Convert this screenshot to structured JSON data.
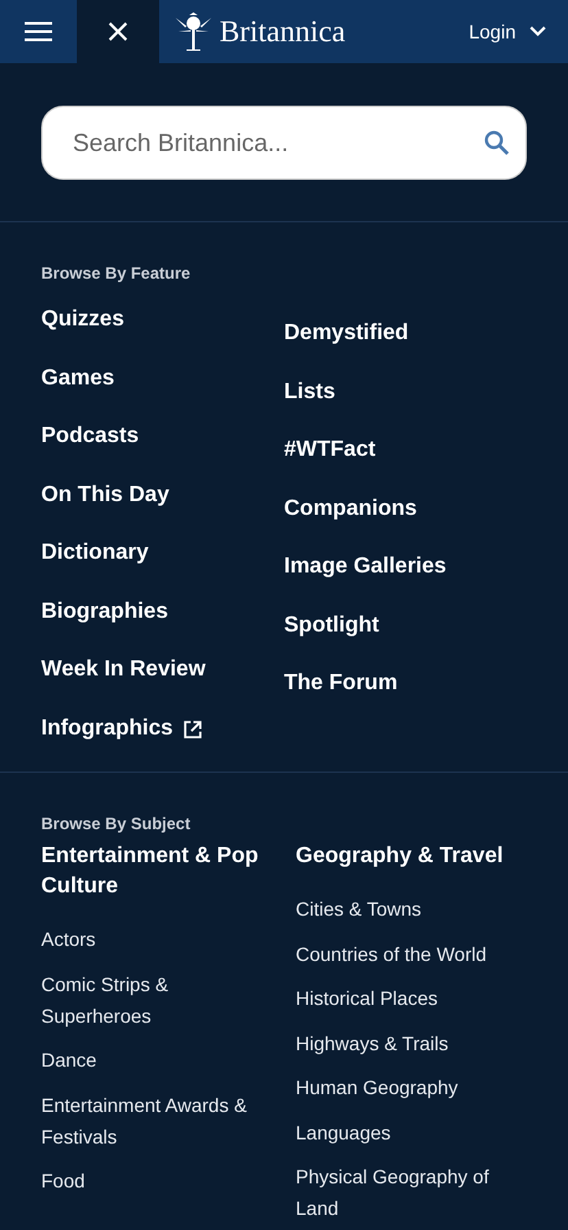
{
  "header": {
    "logo_text": "Britannica",
    "login": "Login"
  },
  "search": {
    "placeholder": "Search Britannica..."
  },
  "features": {
    "title": "Browse By Feature",
    "columns": [
      [
        {
          "label": "Quizzes",
          "kind": "link"
        },
        {
          "label": "Games",
          "kind": "link"
        },
        {
          "label": "Podcasts",
          "kind": "link"
        },
        {
          "label": "On This Day",
          "kind": "link"
        },
        {
          "label": "Dictionary",
          "kind": "link"
        },
        {
          "label": "Biographies",
          "kind": "link"
        },
        {
          "label": "Week In Review",
          "kind": "link"
        },
        {
          "label": "Infographics",
          "kind": "external"
        }
      ],
      [
        {
          "label": "Demystified",
          "kind": "link"
        },
        {
          "label": "Lists",
          "kind": "link"
        },
        {
          "label": "#WTFact",
          "kind": "link"
        },
        {
          "label": "Companions",
          "kind": "link"
        },
        {
          "label": "Image Galleries",
          "kind": "link"
        },
        {
          "label": "Spotlight",
          "kind": "link"
        },
        {
          "label": "The Forum",
          "kind": "link"
        }
      ]
    ]
  },
  "subjects": {
    "title": "Browse By Subject",
    "columns": [
      {
        "heading": "Entertainment & Pop Culture",
        "items": [
          "Actors",
          "Comic Strips & Superheroes",
          "Dance",
          "Entertainment Awards & Festivals",
          "Food"
        ]
      },
      {
        "heading": "Geography & Travel",
        "items": [
          "Cities & Towns",
          "Countries of the World",
          "Historical Places",
          "Highways & Trails",
          "Human Geography",
          "Languages",
          "Physical Geography of Land"
        ]
      }
    ]
  }
}
